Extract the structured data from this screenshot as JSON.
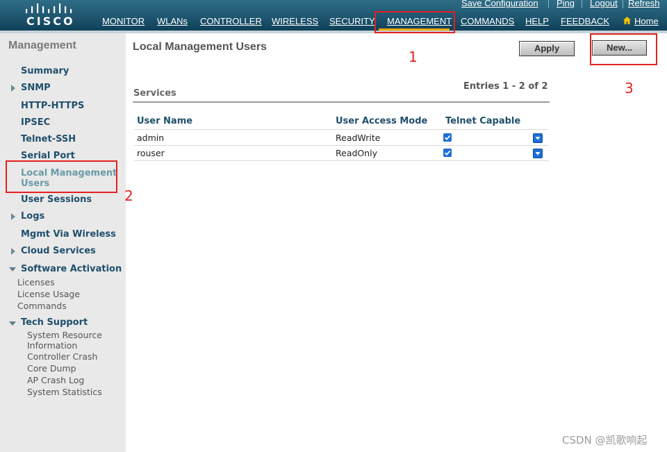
{
  "brand": {
    "logo_text": "CISCO"
  },
  "utility_links": [
    "Save Configuration",
    "Ping",
    "Logout",
    "Refresh"
  ],
  "nav": {
    "monitor": "MONITOR",
    "wlans": "WLANs",
    "controller": "CONTROLLER",
    "wireless": "WIRELESS",
    "security": "SECURITY",
    "management": "MANAGEMENT",
    "commands": "COMMANDS",
    "help": "HELP",
    "feedback": "FEEDBACK",
    "home": "Home"
  },
  "sidebar": {
    "title": "Management",
    "items": {
      "summary": "Summary",
      "snmp": "SNMP",
      "http_https": "HTTP-HTTPS",
      "ipsec": "IPSEC",
      "telnet_ssh": "Telnet-SSH",
      "serial_port": "Serial Port",
      "local_mgmt_users_line1": "Local Management",
      "local_mgmt_users_line2": "Users",
      "user_sessions": "User Sessions",
      "logs": "Logs",
      "mgmt_via_wireless": "Mgmt Via Wireless",
      "cloud_services": "Cloud Services",
      "software_activation": "Software Activation",
      "tech_support": "Tech Support"
    },
    "software_activation_sub": [
      "Licenses",
      "License Usage",
      "Commands"
    ],
    "tech_support_sub": [
      "System Resource",
      "Information",
      "Controller Crash",
      "Core Dump",
      "AP Crash Log",
      "System Statistics"
    ]
  },
  "main": {
    "title": "Local Management Users",
    "apply_label": "Apply",
    "new_label": "New...",
    "entries": "Entries 1 - 2 of 2",
    "section": "Services",
    "columns": [
      "User Name",
      "User Access Mode",
      "Telnet Capable"
    ],
    "rows": [
      {
        "user": "admin",
        "mode": "ReadWrite",
        "telnet": true
      },
      {
        "user": "rouser",
        "mode": "ReadOnly",
        "telnet": true
      }
    ]
  },
  "annotations": {
    "n1": "1",
    "n2": "2",
    "n3": "3",
    "color": "#e42020"
  },
  "watermark": "CSDN @凯歌响起",
  "colors": {
    "header": "#1f5670",
    "nav_active": "#f0a800",
    "sidebar_bg": "#e9e9e9",
    "link": "#1f4f6c"
  }
}
